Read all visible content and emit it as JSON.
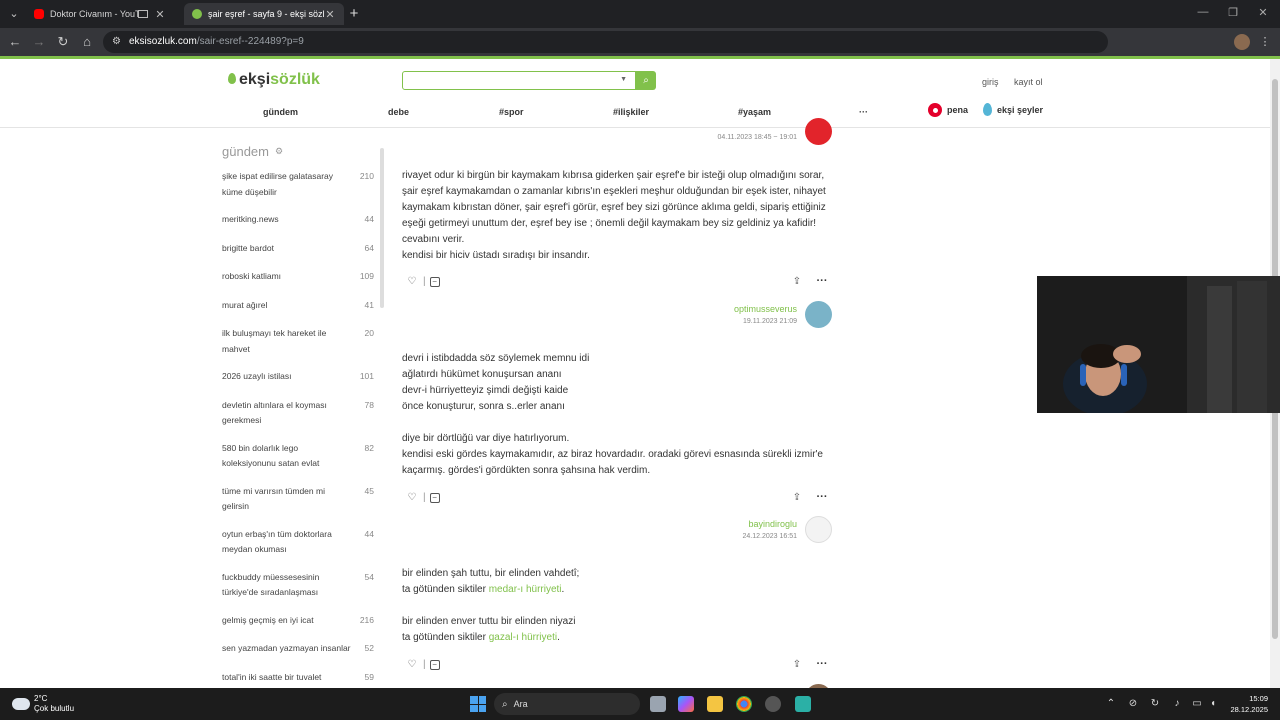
{
  "browser": {
    "tabs": [
      {
        "title": "Doktor Civanım - YouTube",
        "active": false
      },
      {
        "title": "şair eşref - sayfa 9 - ekşi sözlük",
        "active": true
      }
    ],
    "url_host": "eksisozluk.com",
    "url_path": "/sair-esref--224489?p=9"
  },
  "site": {
    "logo_main": "ekşi",
    "logo_accent": "sözlük",
    "login": "giriş",
    "register": "kayıt ol",
    "nav": [
      "gündem",
      "debe",
      "#spor",
      "#ilişkiler",
      "#yaşam",
      "···"
    ],
    "pena": "pena",
    "eksi_seyler": "ekşi şeyler",
    "colors": {
      "accent": "#81c14b",
      "pena": "#e4002b"
    }
  },
  "sidebar": {
    "title": "gündem",
    "items": [
      {
        "label": "şike ispat edilirse galatasaray küme düşebilir",
        "count": "210"
      },
      {
        "label": "meritking.news",
        "count": "44"
      },
      {
        "label": "brigitte bardot",
        "count": "64"
      },
      {
        "label": "roboski katliamı",
        "count": "109"
      },
      {
        "label": "murat ağırel",
        "count": "41"
      },
      {
        "label": "ilk buluşmayı tek hareket ile mahvet",
        "count": "20"
      },
      {
        "label": "2026 uzaylı istilası",
        "count": "101"
      },
      {
        "label": "devletin altınlara el koyması gerekmesi",
        "count": "78"
      },
      {
        "label": "580 bin dolarlık lego koleksiyonunu satan evlat",
        "count": "82"
      },
      {
        "label": "tüme mi varırsın tümden mi gelirsin",
        "count": "45"
      },
      {
        "label": "oytun erbaş'ın tüm doktorlara meydan okuması",
        "count": "44"
      },
      {
        "label": "fuckbuddy müessesesinin türkiye'de sıradanlaşması",
        "count": "54"
      },
      {
        "label": "gelmiş geçmiş en iyi icat",
        "count": "216"
      },
      {
        "label": "sen yazmadan yazmayan insanlar",
        "count": "52"
      },
      {
        "label": "total'in iki saatte bir tuvalet",
        "count": "59"
      }
    ]
  },
  "entries": [
    {
      "date": "04.11.2023 18:45 ~ 19:01",
      "lines": [
        "rivayet odur ki birgün bir kaymakam kıbrısa giderken şair eşref'e bir isteği olup olmadığını sorar,",
        "şair eşref kaymakamdan o zamanlar kıbrıs'ın eşekleri meşhur olduğundan bir eşek ister, nihayet",
        "kaymakam kıbrıstan döner, şair eşref'i görür, eşref bey sizi görünce aklıma geldi, sipariş ettiğiniz",
        "eşeği getirmeyi unuttum der, eşref bey ise ; önemli değil kaymakam bey siz geldiniz ya kafidir!",
        "cevabını verir.",
        "kendisi bir hiciv üstadı sıradışı bir insandır."
      ]
    },
    {
      "author": "optimusseverus",
      "date": "19.11.2023 21:09",
      "lines": [
        "devri i istibdadda söz söylemek memnu idi",
        "ağlatırdı hükümet konuşursan ananı",
        "devr-i hürriyetteyiz şimdi değişti kaide",
        "önce konuşturur, sonra s..erler ananı",
        "",
        "diye bir dörtlüğü var diye hatırlıyorum.",
        "kendisi eski gördes kaymakamıdır, az biraz hovardadır. oradaki görevi esnasında sürekli izmir'e",
        "kaçarmış. gördes'i gördükten sonra şahsına hak verdim."
      ]
    },
    {
      "author": "bayindiroglu",
      "date": "24.12.2023 16:51",
      "line1": "bir elinden şah tuttu, bir elinden vahdetî;",
      "line2_pre": "ta götünden siktiler ",
      "line2_link": "medar-ı hürriyeti",
      "line2_post": ".",
      "line3": "bir elinden enver tuttu bir elinden niyazi",
      "line4_pre": "ta götünden siktiler ",
      "line4_link": "gazal-ı hürriyeti",
      "line4_post": "."
    }
  ],
  "taskbar": {
    "temp": "2°C",
    "weather": "Çok bulutlu",
    "search": "Ara",
    "time": "15:09",
    "date": "28.12.2025"
  }
}
